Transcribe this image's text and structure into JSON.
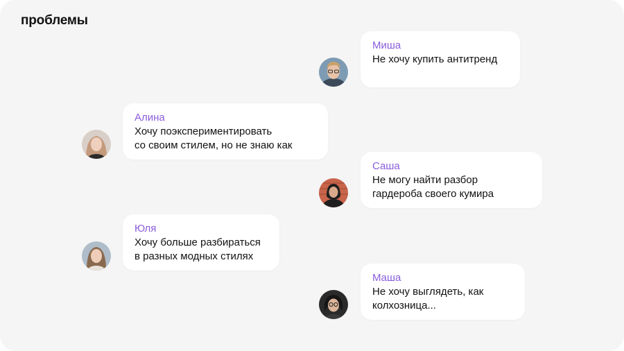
{
  "page": {
    "title": "проблемы"
  },
  "messages": [
    {
      "name": "Миша",
      "text": "Не хочу купить антитренд",
      "avatar": "avatar-misha-icon"
    },
    {
      "name": "Алина",
      "text": "Хочу поэкспериментировать\nсо своим стилем, но не знаю как",
      "avatar": "avatar-alina-icon"
    },
    {
      "name": "Саша",
      "text": "Не могу найти разбор\nгардероба своего кумира",
      "avatar": "avatar-sasha-icon"
    },
    {
      "name": "Юля",
      "text": "Хочу больше разбираться\nв разных модных стилях",
      "avatar": "avatar-yulia-icon"
    },
    {
      "name": "Маша",
      "text": "Не хочу выглядеть, как\nколхозница...",
      "avatar": "avatar-masha-icon"
    }
  ],
  "colors": {
    "background": "#f5f5f5",
    "bubble": "#ffffff",
    "accent_name": "#8a5cdb",
    "text": "#111111"
  }
}
